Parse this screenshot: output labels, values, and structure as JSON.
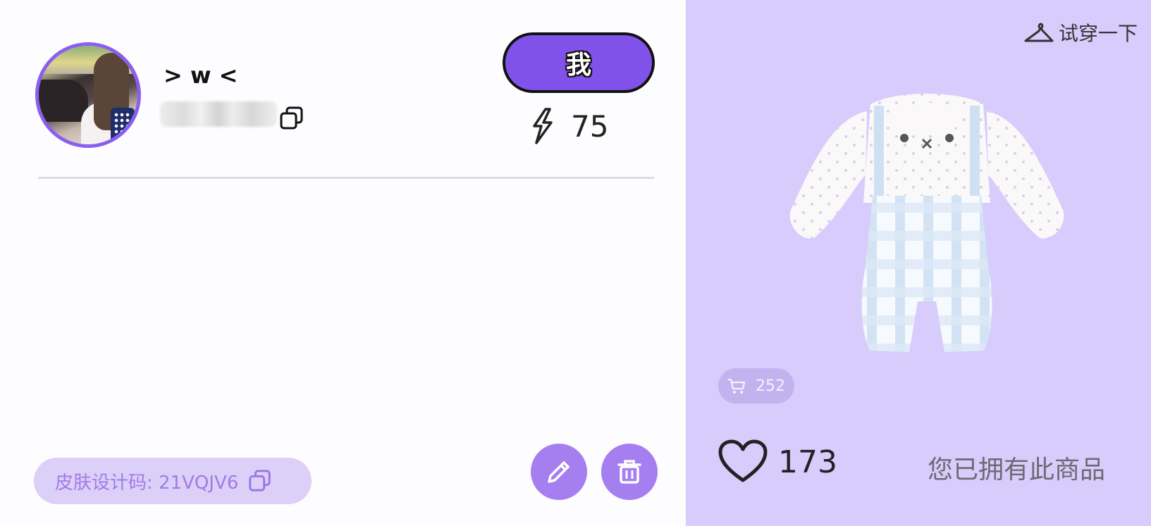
{
  "profile": {
    "username": "> w <",
    "me_button_label": "我",
    "energy_value": "75"
  },
  "footer": {
    "design_code_label": "皮肤设计码: 21VQJV6"
  },
  "item": {
    "try_on_label": "试穿一下",
    "cart_count": "252",
    "like_count": "173",
    "owned_label": "您已拥有此商品"
  },
  "colors": {
    "accent": "#8152ea",
    "panel_bg": "#d8ccfc",
    "soft_accent": "#a57ef0"
  }
}
